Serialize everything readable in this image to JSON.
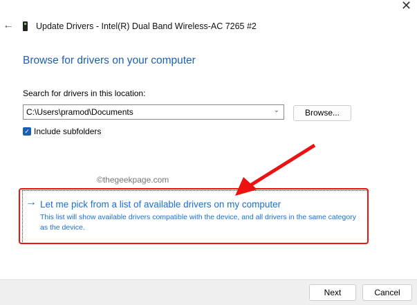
{
  "window": {
    "title": "Update Drivers - Intel(R) Dual Band Wireless-AC 7265 #2",
    "close": "✕",
    "back": "←"
  },
  "main": {
    "heading": "Browse for drivers on your computer",
    "search_label": "Search for drivers in this location:",
    "path_value": "C:\\Users\\pramod\\Documents",
    "browse_label": "Browse...",
    "include_subfolders": "Include subfolders",
    "include_checked": true
  },
  "watermark": "©thegeekpage.com",
  "option": {
    "title": "Let me pick from a list of available drivers on my computer",
    "description": "This list will show available drivers compatible with the device, and all drivers in the same category as the device."
  },
  "footer": {
    "next": "Next",
    "cancel": "Cancel"
  },
  "colors": {
    "accent": "#1a5fb4",
    "annotation": "#e11111"
  }
}
